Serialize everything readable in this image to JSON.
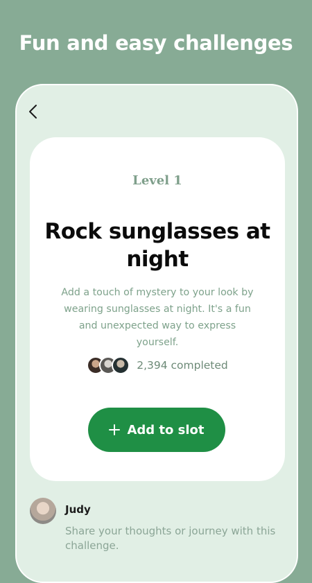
{
  "header": {
    "headline": "Fun and easy challenges"
  },
  "challenge": {
    "level": "Level 1",
    "title": "Rock sunglasses at night",
    "description": "Add a touch of mystery to your look by wearing sunglasses at night. It's a fun and unexpected way to express yourself.",
    "completed_text": "2,394 completed",
    "add_button_label": "Add to slot"
  },
  "comment": {
    "user_name": "Judy",
    "prompt": "Share your thoughts or journey with this challenge."
  },
  "colors": {
    "background": "#87ab95",
    "phone_bg": "#e1efe5",
    "accent_green": "#1f8f45",
    "muted_green_text": "#7ea28b"
  },
  "icons": [
    "back-arrow-icon",
    "plus-icon"
  ]
}
